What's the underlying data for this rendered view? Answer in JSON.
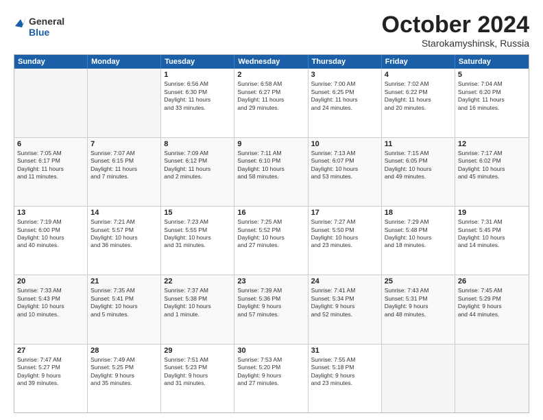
{
  "header": {
    "logo_general": "General",
    "logo_blue": "Blue",
    "month_title": "October 2024",
    "subtitle": "Starokamyshinsk, Russia"
  },
  "weekdays": [
    "Sunday",
    "Monday",
    "Tuesday",
    "Wednesday",
    "Thursday",
    "Friday",
    "Saturday"
  ],
  "rows": [
    [
      {
        "day": "",
        "lines": [],
        "empty": true
      },
      {
        "day": "",
        "lines": [],
        "empty": true
      },
      {
        "day": "1",
        "lines": [
          "Sunrise: 6:56 AM",
          "Sunset: 6:30 PM",
          "Daylight: 11 hours",
          "and 33 minutes."
        ],
        "empty": false
      },
      {
        "day": "2",
        "lines": [
          "Sunrise: 6:58 AM",
          "Sunset: 6:27 PM",
          "Daylight: 11 hours",
          "and 29 minutes."
        ],
        "empty": false
      },
      {
        "day": "3",
        "lines": [
          "Sunrise: 7:00 AM",
          "Sunset: 6:25 PM",
          "Daylight: 11 hours",
          "and 24 minutes."
        ],
        "empty": false
      },
      {
        "day": "4",
        "lines": [
          "Sunrise: 7:02 AM",
          "Sunset: 6:22 PM",
          "Daylight: 11 hours",
          "and 20 minutes."
        ],
        "empty": false
      },
      {
        "day": "5",
        "lines": [
          "Sunrise: 7:04 AM",
          "Sunset: 6:20 PM",
          "Daylight: 11 hours",
          "and 16 minutes."
        ],
        "empty": false
      }
    ],
    [
      {
        "day": "6",
        "lines": [
          "Sunrise: 7:05 AM",
          "Sunset: 6:17 PM",
          "Daylight: 11 hours",
          "and 11 minutes."
        ],
        "empty": false
      },
      {
        "day": "7",
        "lines": [
          "Sunrise: 7:07 AM",
          "Sunset: 6:15 PM",
          "Daylight: 11 hours",
          "and 7 minutes."
        ],
        "empty": false
      },
      {
        "day": "8",
        "lines": [
          "Sunrise: 7:09 AM",
          "Sunset: 6:12 PM",
          "Daylight: 11 hours",
          "and 2 minutes."
        ],
        "empty": false
      },
      {
        "day": "9",
        "lines": [
          "Sunrise: 7:11 AM",
          "Sunset: 6:10 PM",
          "Daylight: 10 hours",
          "and 58 minutes."
        ],
        "empty": false
      },
      {
        "day": "10",
        "lines": [
          "Sunrise: 7:13 AM",
          "Sunset: 6:07 PM",
          "Daylight: 10 hours",
          "and 53 minutes."
        ],
        "empty": false
      },
      {
        "day": "11",
        "lines": [
          "Sunrise: 7:15 AM",
          "Sunset: 6:05 PM",
          "Daylight: 10 hours",
          "and 49 minutes."
        ],
        "empty": false
      },
      {
        "day": "12",
        "lines": [
          "Sunrise: 7:17 AM",
          "Sunset: 6:02 PM",
          "Daylight: 10 hours",
          "and 45 minutes."
        ],
        "empty": false
      }
    ],
    [
      {
        "day": "13",
        "lines": [
          "Sunrise: 7:19 AM",
          "Sunset: 6:00 PM",
          "Daylight: 10 hours",
          "and 40 minutes."
        ],
        "empty": false
      },
      {
        "day": "14",
        "lines": [
          "Sunrise: 7:21 AM",
          "Sunset: 5:57 PM",
          "Daylight: 10 hours",
          "and 36 minutes."
        ],
        "empty": false
      },
      {
        "day": "15",
        "lines": [
          "Sunrise: 7:23 AM",
          "Sunset: 5:55 PM",
          "Daylight: 10 hours",
          "and 31 minutes."
        ],
        "empty": false
      },
      {
        "day": "16",
        "lines": [
          "Sunrise: 7:25 AM",
          "Sunset: 5:52 PM",
          "Daylight: 10 hours",
          "and 27 minutes."
        ],
        "empty": false
      },
      {
        "day": "17",
        "lines": [
          "Sunrise: 7:27 AM",
          "Sunset: 5:50 PM",
          "Daylight: 10 hours",
          "and 23 minutes."
        ],
        "empty": false
      },
      {
        "day": "18",
        "lines": [
          "Sunrise: 7:29 AM",
          "Sunset: 5:48 PM",
          "Daylight: 10 hours",
          "and 18 minutes."
        ],
        "empty": false
      },
      {
        "day": "19",
        "lines": [
          "Sunrise: 7:31 AM",
          "Sunset: 5:45 PM",
          "Daylight: 10 hours",
          "and 14 minutes."
        ],
        "empty": false
      }
    ],
    [
      {
        "day": "20",
        "lines": [
          "Sunrise: 7:33 AM",
          "Sunset: 5:43 PM",
          "Daylight: 10 hours",
          "and 10 minutes."
        ],
        "empty": false
      },
      {
        "day": "21",
        "lines": [
          "Sunrise: 7:35 AM",
          "Sunset: 5:41 PM",
          "Daylight: 10 hours",
          "and 5 minutes."
        ],
        "empty": false
      },
      {
        "day": "22",
        "lines": [
          "Sunrise: 7:37 AM",
          "Sunset: 5:38 PM",
          "Daylight: 10 hours",
          "and 1 minute."
        ],
        "empty": false
      },
      {
        "day": "23",
        "lines": [
          "Sunrise: 7:39 AM",
          "Sunset: 5:36 PM",
          "Daylight: 9 hours",
          "and 57 minutes."
        ],
        "empty": false
      },
      {
        "day": "24",
        "lines": [
          "Sunrise: 7:41 AM",
          "Sunset: 5:34 PM",
          "Daylight: 9 hours",
          "and 52 minutes."
        ],
        "empty": false
      },
      {
        "day": "25",
        "lines": [
          "Sunrise: 7:43 AM",
          "Sunset: 5:31 PM",
          "Daylight: 9 hours",
          "and 48 minutes."
        ],
        "empty": false
      },
      {
        "day": "26",
        "lines": [
          "Sunrise: 7:45 AM",
          "Sunset: 5:29 PM",
          "Daylight: 9 hours",
          "and 44 minutes."
        ],
        "empty": false
      }
    ],
    [
      {
        "day": "27",
        "lines": [
          "Sunrise: 7:47 AM",
          "Sunset: 5:27 PM",
          "Daylight: 9 hours",
          "and 39 minutes."
        ],
        "empty": false
      },
      {
        "day": "28",
        "lines": [
          "Sunrise: 7:49 AM",
          "Sunset: 5:25 PM",
          "Daylight: 9 hours",
          "and 35 minutes."
        ],
        "empty": false
      },
      {
        "day": "29",
        "lines": [
          "Sunrise: 7:51 AM",
          "Sunset: 5:23 PM",
          "Daylight: 9 hours",
          "and 31 minutes."
        ],
        "empty": false
      },
      {
        "day": "30",
        "lines": [
          "Sunrise: 7:53 AM",
          "Sunset: 5:20 PM",
          "Daylight: 9 hours",
          "and 27 minutes."
        ],
        "empty": false
      },
      {
        "day": "31",
        "lines": [
          "Sunrise: 7:55 AM",
          "Sunset: 5:18 PM",
          "Daylight: 9 hours",
          "and 23 minutes."
        ],
        "empty": false
      },
      {
        "day": "",
        "lines": [],
        "empty": true
      },
      {
        "day": "",
        "lines": [],
        "empty": true
      }
    ]
  ]
}
